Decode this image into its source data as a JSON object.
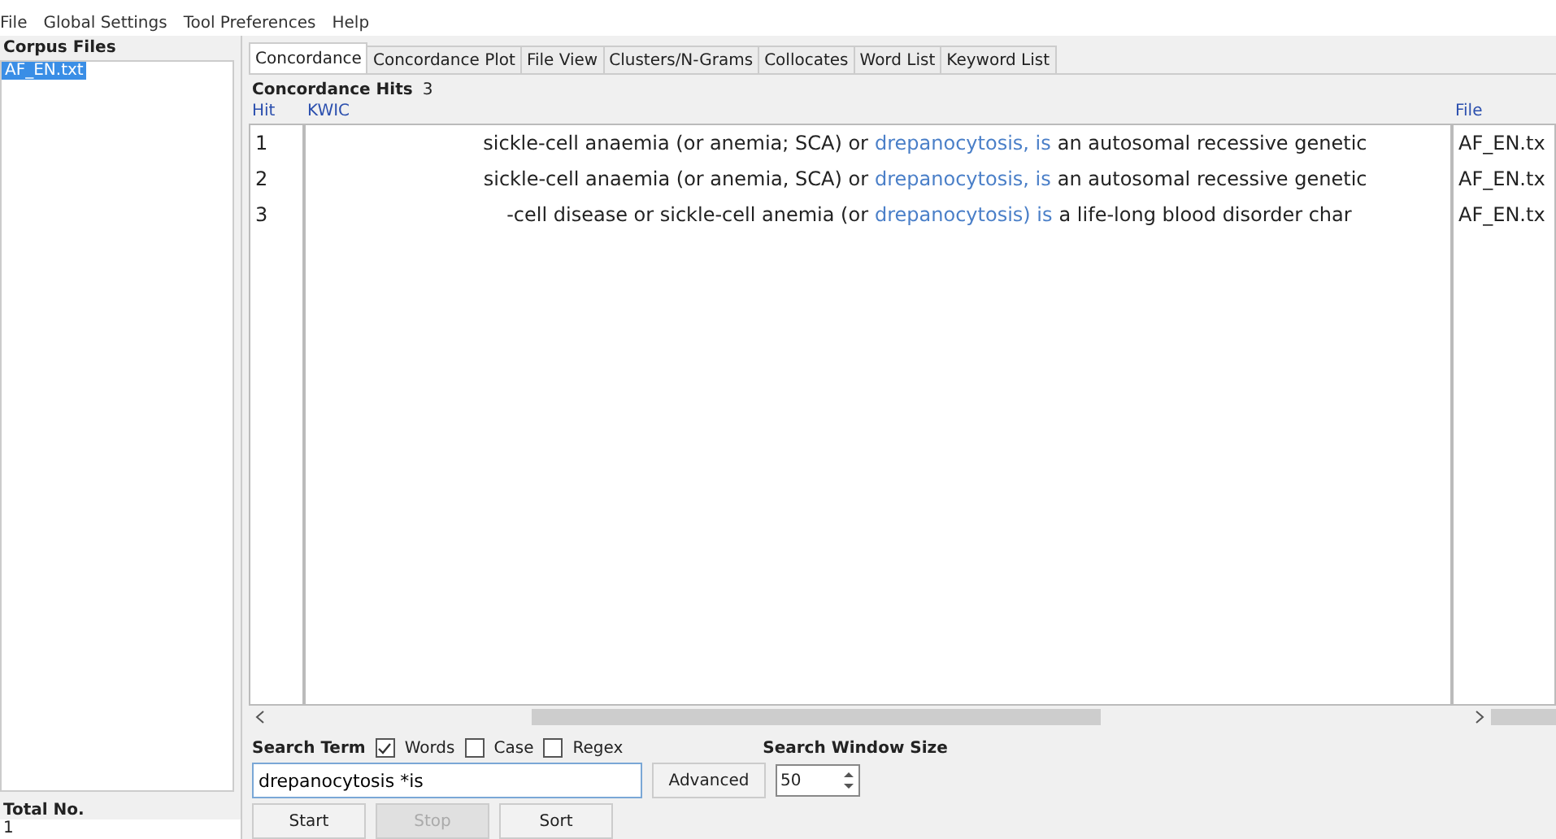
{
  "menu": [
    "File",
    "Global Settings",
    "Tool Preferences",
    "Help"
  ],
  "corpus_files": {
    "title": "Corpus Files",
    "files": [
      {
        "name": "AF_EN.txt",
        "selected": true
      }
    ],
    "total_label": "Total No.",
    "total_value": "1"
  },
  "tabs": [
    {
      "label": "Concordance",
      "selected": true
    },
    {
      "label": "Concordance Plot",
      "selected": false
    },
    {
      "label": "File View",
      "selected": false
    },
    {
      "label": "Clusters/N-Grams",
      "selected": false
    },
    {
      "label": "Collocates",
      "selected": false
    },
    {
      "label": "Word List",
      "selected": false
    },
    {
      "label": "Keyword List",
      "selected": false
    }
  ],
  "hits_label": "Concordance Hits",
  "hits_count": "3",
  "columns": {
    "hit": "Hit",
    "kwic": "KWIC",
    "file": "File"
  },
  "rows": [
    {
      "hit": "1",
      "left": "sickle-cell anaemia (or anemia; SCA) or",
      "keyword": "drepanocytosis, is",
      "right": "an autosomal recessive genetic",
      "file": "AF_EN.tx"
    },
    {
      "hit": "2",
      "left": "sickle-cell anaemia (or anemia, SCA) or",
      "keyword": "drepanocytosis, is",
      "right": "an autosomal recessive genetic",
      "file": "AF_EN.tx"
    },
    {
      "hit": "3",
      "left": "-cell disease or sickle-cell anemia (or",
      "keyword": "drepanocytosis) is",
      "right": "a life-long blood disorder char",
      "file": "AF_EN.tx"
    }
  ],
  "search": {
    "label": "Search Term",
    "options": [
      {
        "label": "Words",
        "checked": true
      },
      {
        "label": "Case",
        "checked": false
      },
      {
        "label": "Regex",
        "checked": false
      }
    ],
    "value": "drepanocytosis *is",
    "advanced": "Advanced",
    "window_label": "Search Window Size",
    "window_value": "50"
  },
  "buttons": [
    {
      "label": "Start",
      "disabled": false
    },
    {
      "label": "Stop",
      "disabled": true
    },
    {
      "label": "Sort",
      "disabled": false
    }
  ]
}
